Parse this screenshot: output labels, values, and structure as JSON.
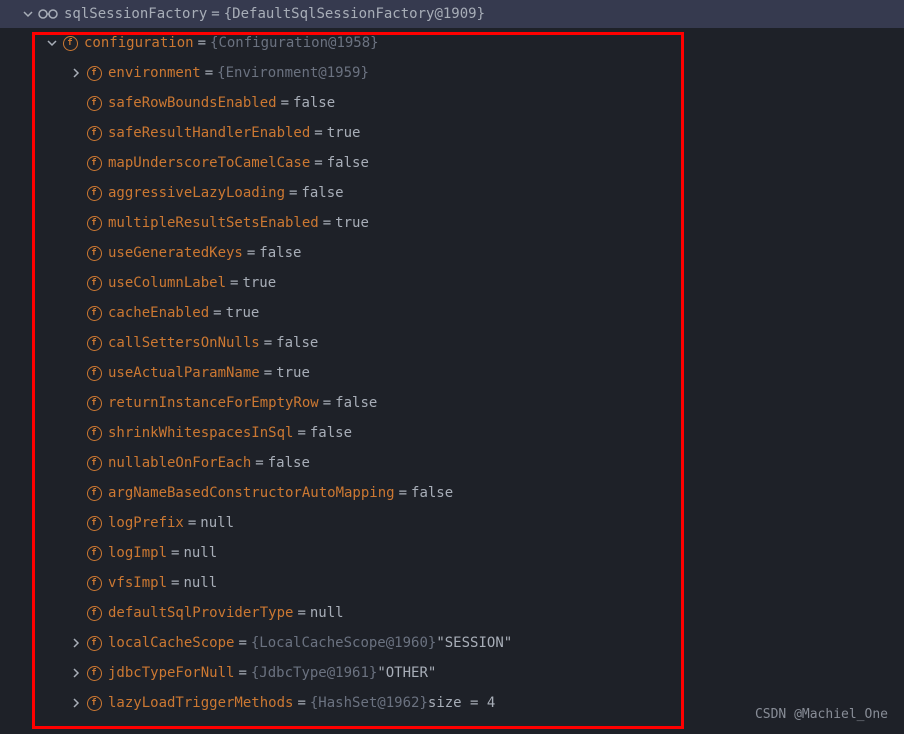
{
  "root": {
    "name": "sqlSessionFactory",
    "type": "{DefaultSqlSessionFactory@1909}"
  },
  "config": {
    "name": "configuration",
    "type": "{Configuration@1958}"
  },
  "watermark": "CSDN @Machiel_One",
  "fields": [
    {
      "name": "environment",
      "type": "{Environment@1959}",
      "value": "",
      "hasChevron": true
    },
    {
      "name": "safeRowBoundsEnabled",
      "type": "",
      "value": "false",
      "hasChevron": false
    },
    {
      "name": "safeResultHandlerEnabled",
      "type": "",
      "value": "true",
      "hasChevron": false
    },
    {
      "name": "mapUnderscoreToCamelCase",
      "type": "",
      "value": "false",
      "hasChevron": false
    },
    {
      "name": "aggressiveLazyLoading",
      "type": "",
      "value": "false",
      "hasChevron": false
    },
    {
      "name": "multipleResultSetsEnabled",
      "type": "",
      "value": "true",
      "hasChevron": false
    },
    {
      "name": "useGeneratedKeys",
      "type": "",
      "value": "false",
      "hasChevron": false
    },
    {
      "name": "useColumnLabel",
      "type": "",
      "value": "true",
      "hasChevron": false
    },
    {
      "name": "cacheEnabled",
      "type": "",
      "value": "true",
      "hasChevron": false
    },
    {
      "name": "callSettersOnNulls",
      "type": "",
      "value": "false",
      "hasChevron": false
    },
    {
      "name": "useActualParamName",
      "type": "",
      "value": "true",
      "hasChevron": false
    },
    {
      "name": "returnInstanceForEmptyRow",
      "type": "",
      "value": "false",
      "hasChevron": false
    },
    {
      "name": "shrinkWhitespacesInSql",
      "type": "",
      "value": "false",
      "hasChevron": false
    },
    {
      "name": "nullableOnForEach",
      "type": "",
      "value": "false",
      "hasChevron": false
    },
    {
      "name": "argNameBasedConstructorAutoMapping",
      "type": "",
      "value": "false",
      "hasChevron": false
    },
    {
      "name": "logPrefix",
      "type": "",
      "value": "null",
      "hasChevron": false
    },
    {
      "name": "logImpl",
      "type": "",
      "value": "null",
      "hasChevron": false
    },
    {
      "name": "vfsImpl",
      "type": "",
      "value": "null",
      "hasChevron": false
    },
    {
      "name": "defaultSqlProviderType",
      "type": "",
      "value": "null",
      "hasChevron": false
    },
    {
      "name": "localCacheScope",
      "type": "{LocalCacheScope@1960}",
      "value": "\"SESSION\"",
      "hasChevron": true
    },
    {
      "name": "jdbcTypeForNull",
      "type": "{JdbcType@1961}",
      "value": "\"OTHER\"",
      "hasChevron": true
    },
    {
      "name": "lazyLoadTriggerMethods",
      "type": "{HashSet@1962}",
      "value": " size = 4",
      "hasChevron": true
    }
  ]
}
